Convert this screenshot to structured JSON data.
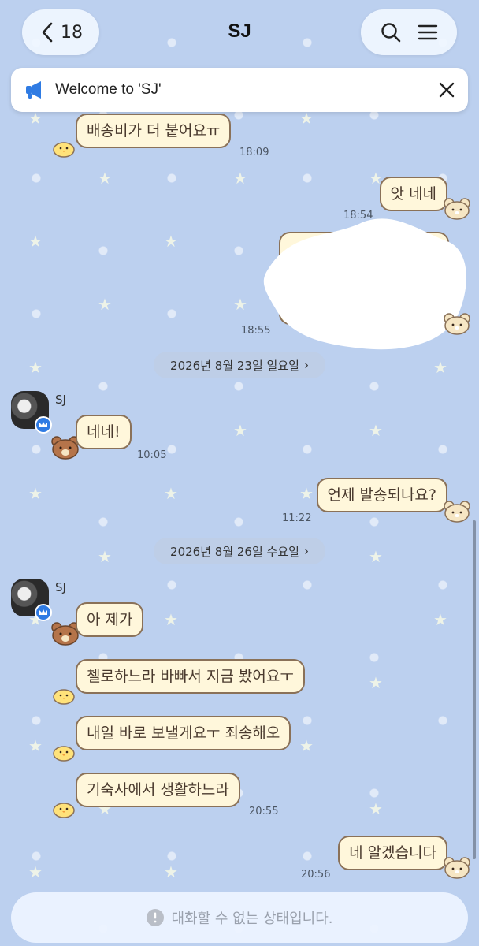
{
  "header": {
    "back_count": "18",
    "title": "SJ",
    "icons": [
      "chevron-left-icon",
      "search-icon",
      "menu-icon"
    ]
  },
  "notice": {
    "text": "Welcome to 'SJ'",
    "icon": "megaphone-icon"
  },
  "messages": [
    {
      "side": "left",
      "text": "배송비가 더 붙어요ㅠ",
      "time": "18:09"
    },
    {
      "side": "right",
      "text": "앗 네네",
      "time": "18:54"
    },
    {
      "side": "right",
      "text": "",
      "time": "18:55",
      "redacted": true
    },
    {
      "side": "left",
      "sender": "SJ",
      "text": "네네!",
      "time": "10:05"
    },
    {
      "side": "right",
      "text": "언제 발송되나요?",
      "time": "11:22"
    },
    {
      "side": "left",
      "sender": "SJ",
      "text": "아 제가",
      "time": ""
    },
    {
      "side": "left",
      "text": "첼로하느라 바빠서 지금 봤어요ㅜ",
      "time": ""
    },
    {
      "side": "left",
      "text": "내일 바로 보낼게요ㅜ 죄송해오",
      "time": ""
    },
    {
      "side": "left",
      "text": "기숙사에서 생활하느라",
      "time": "20:55"
    },
    {
      "side": "right",
      "text": "네 알겠습니다",
      "time": "20:56"
    }
  ],
  "dates": [
    {
      "label": "2026년 8월 23일 일요일"
    },
    {
      "label": "2026년 8월 26일 수요일"
    }
  ],
  "composer": {
    "disabled_text": "대화할 수 없는 상태입니다.",
    "icon": "alert-circle-icon"
  },
  "colors": {
    "background": "#bcd0ef",
    "bubble_fill": "#fff7db",
    "bubble_border": "#8a7158",
    "verified_badge": "#2f7be3",
    "notice_icon": "#2f7be3"
  }
}
